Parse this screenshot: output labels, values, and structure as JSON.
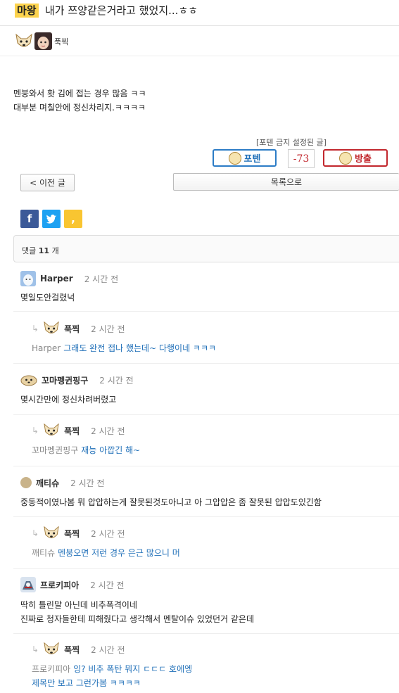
{
  "post": {
    "badge": "마왕",
    "title": "내가 쯔양같은거라고 했었지...ㅎㅎ",
    "author": "푹찍",
    "body_lines": [
      "멘붕와서 홧 김에 접는 경우 많음 ㅋㅋ",
      "대부분 며칠안에 정신차리지.ㅋㅋㅋㅋ"
    ]
  },
  "vote": {
    "caption": "[포텐 금지 설정된 글]",
    "pos_label": "포텐",
    "count": "-73",
    "neg_label": "방출"
  },
  "nav": {
    "prev_label": "< 이전 글",
    "list_label": "목록으로"
  },
  "share": {
    "fb": "f",
    "tw": "t",
    "kakao": ","
  },
  "comments_header": {
    "prefix": "댓글",
    "count": "11",
    "suffix": "개"
  },
  "comments": [
    {
      "name": "Harper",
      "time": "2 시간 전",
      "lines": [
        "몇일도안걸렸넉"
      ]
    },
    {
      "name": "푹찍",
      "time": "2 시간 전",
      "mention": "Harper",
      "lines": [
        "그래도 완전 접나 했는데~ 다행이네 ㅋㅋㅋ"
      ]
    },
    {
      "name": "꼬마펭귄핑구",
      "time": "2 시간 전",
      "lines": [
        "몇시간만에 정신차려버렸고"
      ]
    },
    {
      "name": "푹찍",
      "time": "2 시간 전",
      "mention": "꼬마펭귄핑구",
      "lines": [
        "재능 아깝긴 해~"
      ]
    },
    {
      "name": "깨티슈",
      "time": "2 시간 전",
      "lines": [
        "중동적이였나봄 뭐 압압하는게 잘못된것도아니고 아 그압압은 좀 잘못된 압압도있긴함"
      ]
    },
    {
      "name": "푹찍",
      "time": "2 시간 전",
      "mention": "깨티슈",
      "lines": [
        "멘붕오면 저런 경우 은근 많으니 머"
      ]
    },
    {
      "name": "프로키피아",
      "time": "2 시간 전",
      "lines": [
        "딱히 틀린말 아닌데 비추폭격이네",
        "진짜로 청자들한테 피해줬다고 생각해서 멘탈이슈 있었던거 같은데"
      ]
    },
    {
      "name": "푹찍",
      "time": "2 시간 전",
      "mention": "프로키피아",
      "lines": [
        "잉? 비추 폭탄 뭐지 ㄷㄷㄷ 호에엥",
        "제목만 보고 그런가봄 ㅋㅋㅋㅋ"
      ]
    }
  ],
  "colors": {
    "badge_bg": "#fcd34d",
    "link_blue": "#1f6fb8",
    "downvote_red": "#c2272d"
  }
}
